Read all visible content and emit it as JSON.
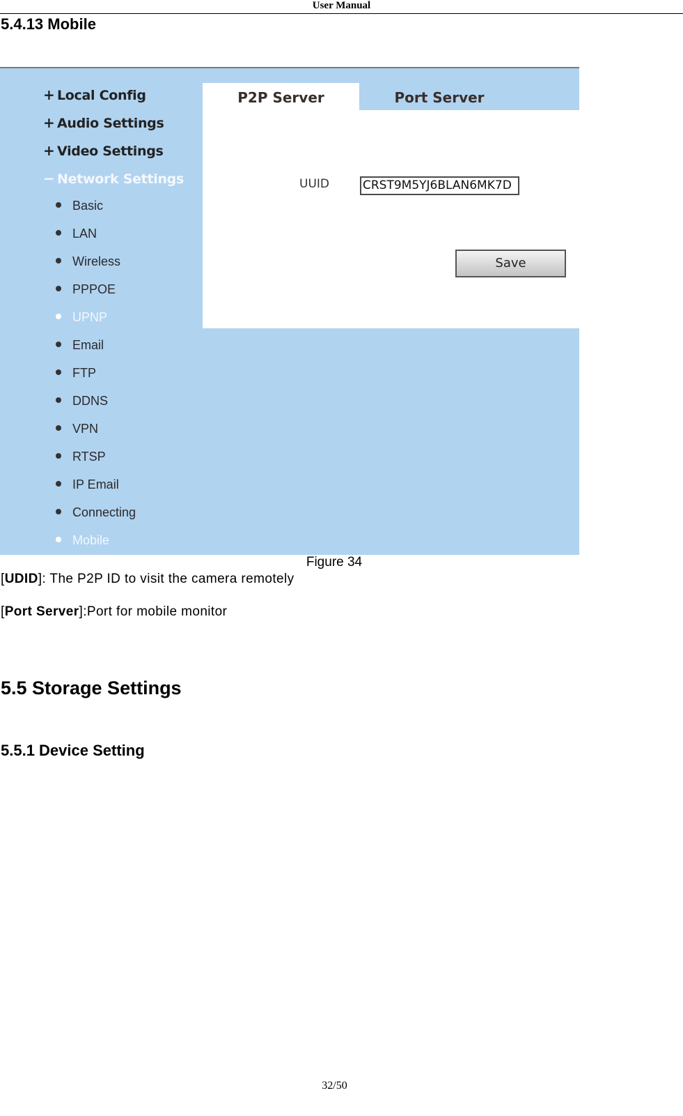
{
  "document": {
    "running_header": "User Manual",
    "page_number": "32/50"
  },
  "sections": {
    "s5413": "5.4.13 Mobile",
    "s55": "5.5 Storage Settings",
    "s551": "5.5.1 Device Setting"
  },
  "figure": {
    "caption": "Figure 34",
    "colors": {
      "panel_bg": "#b0d3f0",
      "active_text": "#f4f8fc",
      "content_bg": "#ffffff"
    },
    "nav": {
      "groups": [
        {
          "sign": "+",
          "label": "Local Config",
          "active": false
        },
        {
          "sign": "+",
          "label": "Audio Settings",
          "active": false
        },
        {
          "sign": "+",
          "label": "Video Settings",
          "active": false
        },
        {
          "sign": "−",
          "label": "Network Settings",
          "active": true
        }
      ],
      "items": [
        {
          "label": "Basic",
          "active": false
        },
        {
          "label": "LAN",
          "active": false
        },
        {
          "label": "Wireless",
          "active": false
        },
        {
          "label": "PPPOE",
          "active": false
        },
        {
          "label": "UPNP",
          "active": true
        },
        {
          "label": "Email",
          "active": false
        },
        {
          "label": "FTP",
          "active": false
        },
        {
          "label": "DDNS",
          "active": false
        },
        {
          "label": "VPN",
          "active": false
        },
        {
          "label": "RTSP",
          "active": false
        },
        {
          "label": "IP Email",
          "active": false
        },
        {
          "label": "Connecting",
          "active": false
        },
        {
          "label": "Mobile",
          "active": true
        }
      ]
    },
    "tabs": [
      {
        "label": "P2P Server",
        "active": true
      },
      {
        "label": "Port Server",
        "active": false
      }
    ],
    "form": {
      "uuid_label": "UUID",
      "uuid_value": "CRST9M5YJ6BLAN6MK7D",
      "save_label": "Save"
    }
  },
  "body_text": {
    "udid": {
      "term": "UDID",
      "open": "[",
      "close": "]",
      "text": ": The P2P ID to visit the camera remotely"
    },
    "port": {
      "term": "Port Server",
      "open": "[",
      "close": "]",
      "text": ":Port for mobile monitor"
    }
  }
}
